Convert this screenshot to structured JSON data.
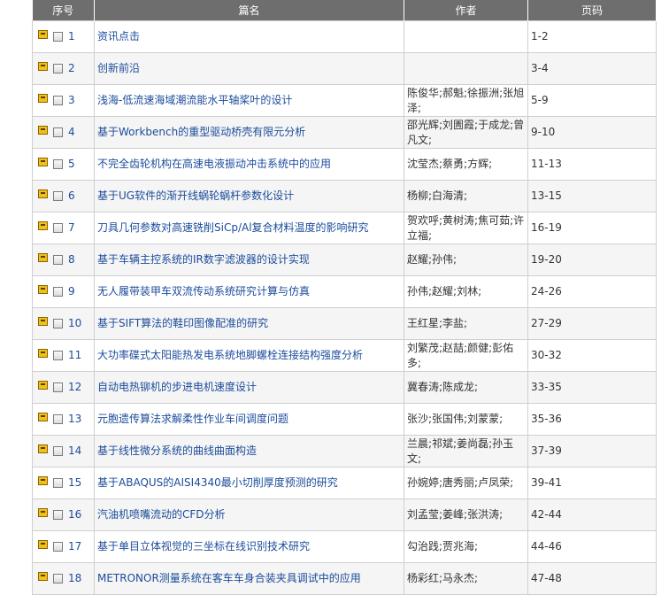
{
  "headers": {
    "seq": "序号",
    "title": "篇名",
    "author": "作者",
    "pages": "页码"
  },
  "articles": [
    {
      "num": "1",
      "title": "资讯点击",
      "author": "",
      "pages": "1-2"
    },
    {
      "num": "2",
      "title": "创新前沿",
      "author": "",
      "pages": "3-4"
    },
    {
      "num": "3",
      "title": "浅海-低流速海域潮流能水平轴桨叶的设计",
      "author": "陈俊华;郝魁;徐振洲;张旭泽;",
      "pages": "5-9"
    },
    {
      "num": "4",
      "title": "基于Workbench的重型驱动桥壳有限元分析",
      "author": "邵光辉;刘圊霞;于成龙;曾凡文;",
      "pages": "9-10"
    },
    {
      "num": "5",
      "title": "不完全齿轮机构在高速电液振动冲击系统中的应用",
      "author": "沈莹杰;蔡勇;方辉;",
      "pages": "11-13"
    },
    {
      "num": "6",
      "title": "基于UG软件的渐开线蜗轮蜗杆参数化设计",
      "author": "杨柳;白海清;",
      "pages": "13-15"
    },
    {
      "num": "7",
      "title": "刀具几何参数对高速铣削SiCp/Al复合材料温度的影响研究",
      "author": "贺欢呼;黄树涛;焦可茹;许立福;",
      "pages": "16-19"
    },
    {
      "num": "8",
      "title": "基于车辆主控系统的IR数字滤波器的设计实现",
      "author": "赵耀;孙伟;",
      "pages": "19-20"
    },
    {
      "num": "9",
      "title": "无人履带装甲车双流传动系统研究计算与仿真",
      "author": "孙伟;赵耀;刘林;",
      "pages": "24-26"
    },
    {
      "num": "10",
      "title": "基于SIFT算法的鞋印图像配准的研究",
      "author": "王红星;李盐;",
      "pages": "27-29"
    },
    {
      "num": "11",
      "title": "大功率碟式太阳能热发电系统地脚螺栓连接结构强度分析",
      "author": "刘繁茂;赵喆;颜健;彭佑多;",
      "pages": "30-32"
    },
    {
      "num": "12",
      "title": "自动电热铆机的步进电机速度设计",
      "author": "冀春涛;陈成龙;",
      "pages": "33-35"
    },
    {
      "num": "13",
      "title": "元胞遗传算法求解柔性作业车间调度问题",
      "author": "张沙;张国伟;刘蒙蒙;",
      "pages": "35-36"
    },
    {
      "num": "14",
      "title": "基于线性微分系统的曲线曲面构造",
      "author": "兰晨;祁斌;姜尚磊;孙玉文;",
      "pages": "37-39"
    },
    {
      "num": "15",
      "title": "基于ABAQUS的AISI4340最小切削厚度预测的研究",
      "author": "孙婉婷;唐秀丽;卢凤荣;",
      "pages": "39-41"
    },
    {
      "num": "16",
      "title": "汽油机喷嘴流动的CFD分析",
      "author": "刘孟莹;姜峰;张洪涛;",
      "pages": "42-44"
    },
    {
      "num": "17",
      "title": "基于单目立体视觉的三坐标在线识别技术研究",
      "author": "勾治践;贾兆海;",
      "pages": "44-46"
    },
    {
      "num": "18",
      "title": "METRONOR测量系统在客车车身合装夹具调试中的应用",
      "author": "杨彩红;马永杰;",
      "pages": "47-48"
    }
  ]
}
